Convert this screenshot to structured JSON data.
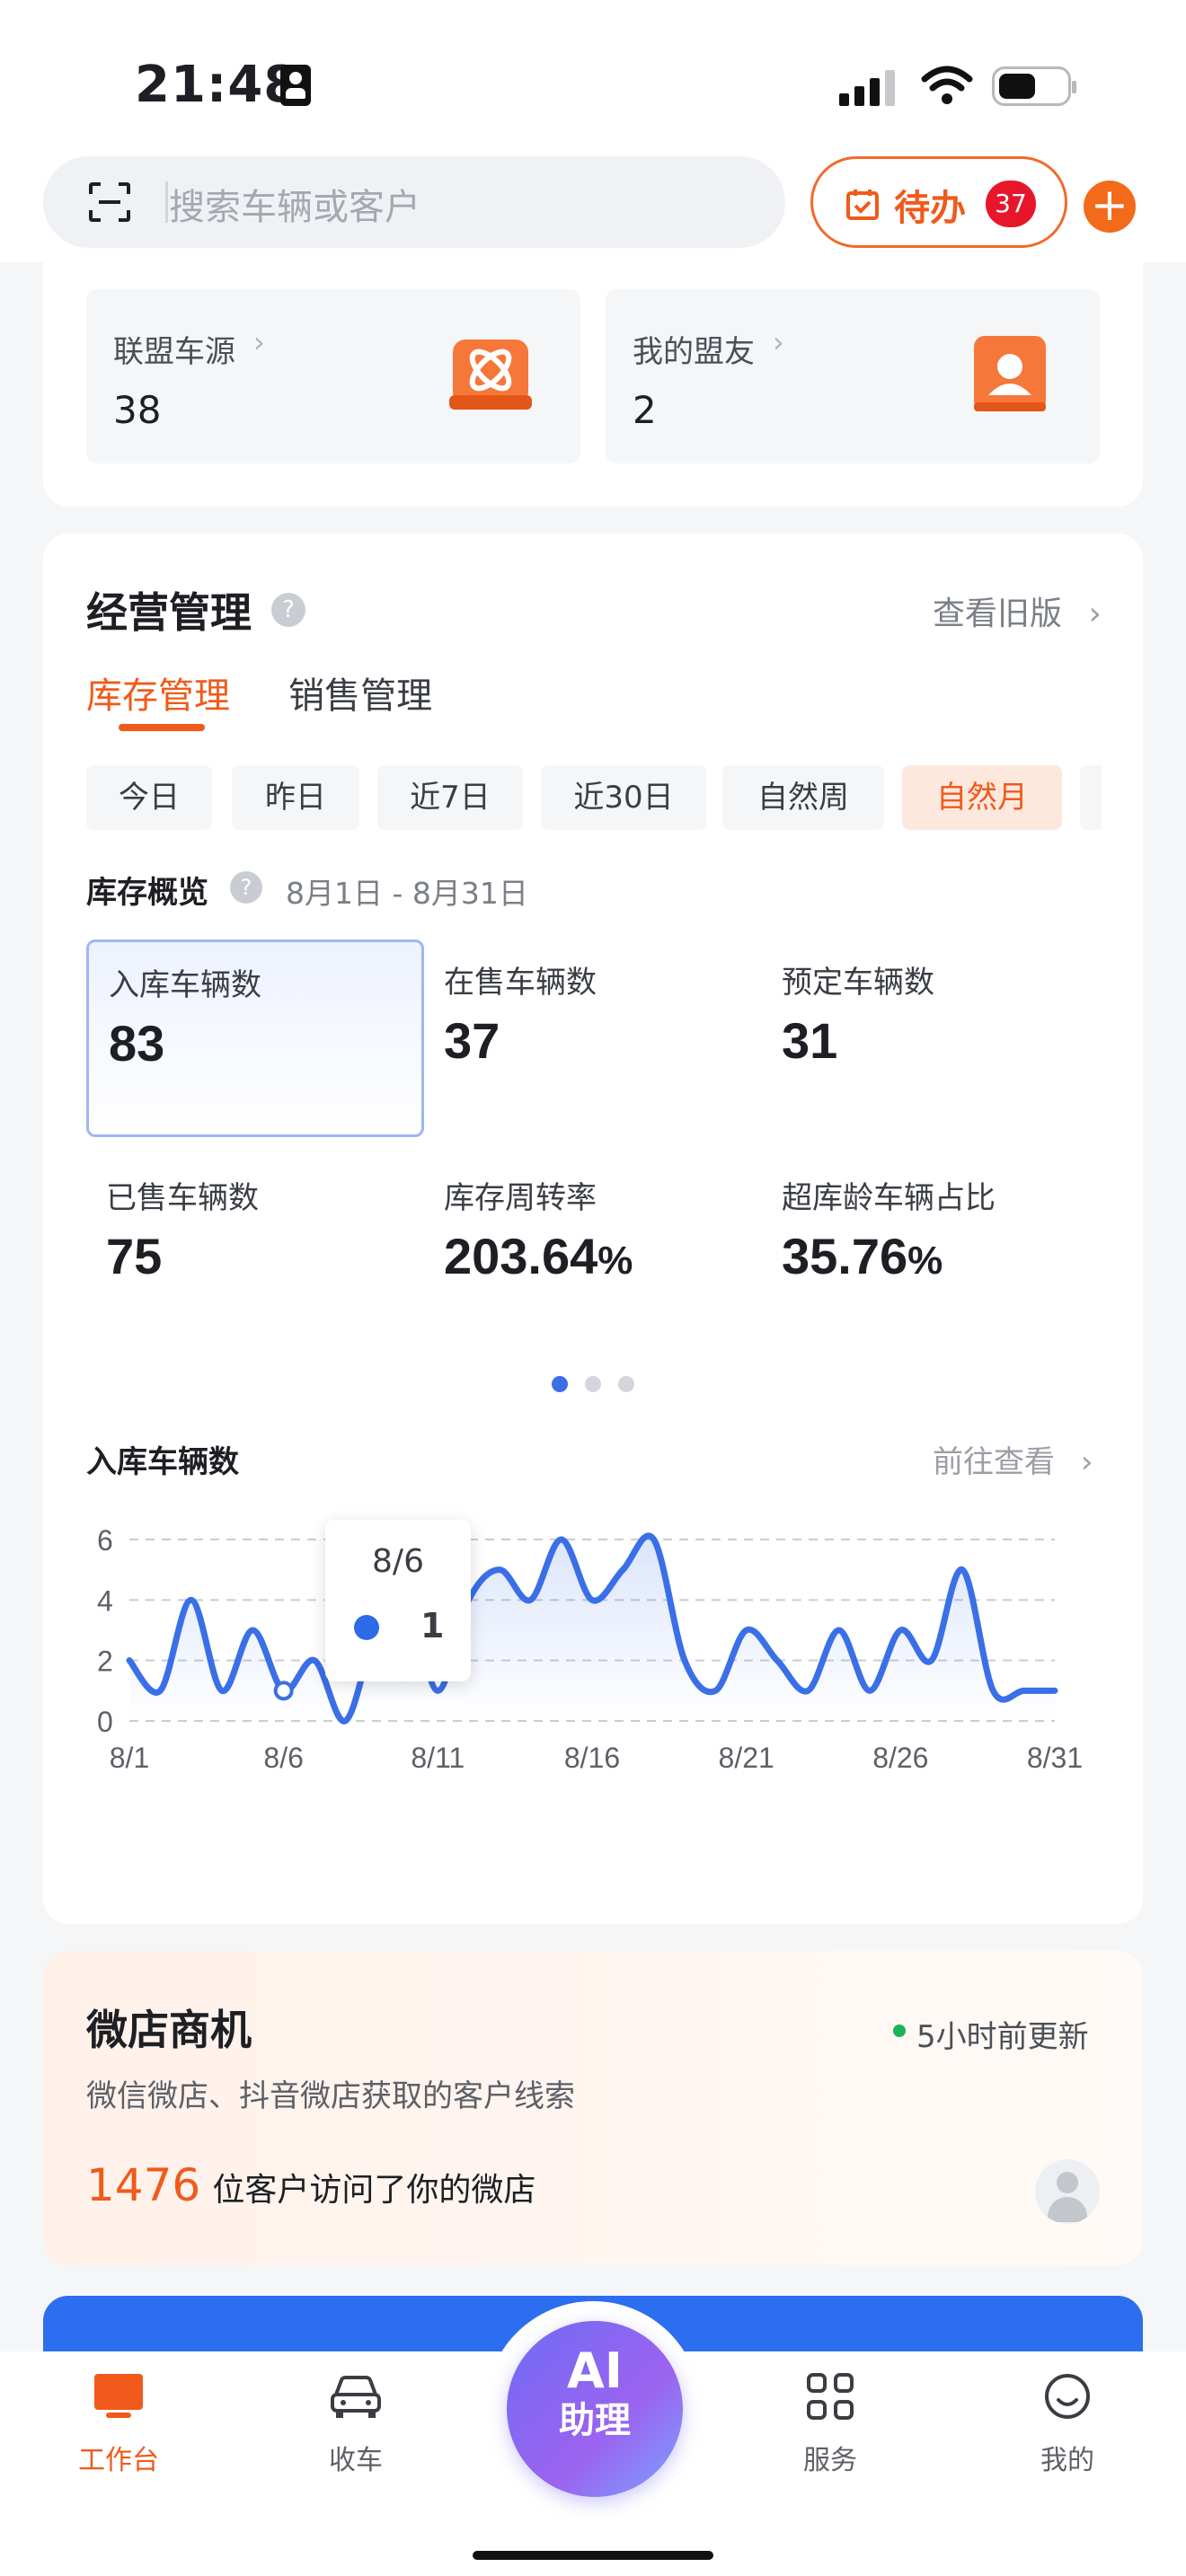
{
  "status": {
    "time": "21:48"
  },
  "search": {
    "placeholder": "搜索车辆或客户"
  },
  "todo": {
    "label": "待办",
    "count": "37"
  },
  "alliance": [
    {
      "label": "联盟车源",
      "value": "38"
    },
    {
      "label": "我的盟友",
      "value": "2"
    }
  ],
  "business": {
    "title": "经营管理",
    "old_version": "查看旧版",
    "tabs": [
      "库存管理",
      "销售管理"
    ],
    "ranges": [
      "今日",
      "昨日",
      "近7日",
      "近30日",
      "自然周",
      "自然月"
    ],
    "overview_label": "库存概览",
    "date_range": "8月1日 - 8月31日",
    "metrics": [
      {
        "label": "入库车辆数",
        "value": "83"
      },
      {
        "label": "在售车辆数",
        "value": "37"
      },
      {
        "label": "预定车辆数",
        "value": "31"
      },
      {
        "label": "已售车辆数",
        "value": "75"
      },
      {
        "label": "库存周转率",
        "value": "203.64",
        "unit": "%"
      },
      {
        "label": "超库龄车辆占比",
        "value": "35.76",
        "unit": "%"
      }
    ],
    "chart_title": "入库车辆数",
    "chart_link": "前往查看",
    "tooltip": {
      "date": "8/6",
      "value": "1"
    }
  },
  "chart_data": {
    "type": "line",
    "x": [
      "8/1",
      "8/2",
      "8/3",
      "8/4",
      "8/5",
      "8/6",
      "8/7",
      "8/8",
      "8/9",
      "8/10",
      "8/11",
      "8/12",
      "8/13",
      "8/14",
      "8/15",
      "8/16",
      "8/17",
      "8/18",
      "8/19",
      "8/20",
      "8/21",
      "8/22",
      "8/23",
      "8/24",
      "8/25",
      "8/26",
      "8/27",
      "8/28",
      "8/29",
      "8/30",
      "8/31"
    ],
    "x_ticks": [
      "8/1",
      "8/6",
      "8/11",
      "8/16",
      "8/21",
      "8/26",
      "8/31"
    ],
    "series": [
      {
        "values": [
          2,
          1,
          4,
          1,
          3,
          1,
          2,
          0,
          3,
          4,
          1,
          4,
          5,
          4,
          6,
          4,
          5,
          6,
          2,
          1,
          3,
          2,
          1,
          3,
          1,
          3,
          2,
          5,
          1,
          1,
          1
        ]
      }
    ],
    "ylim": [
      0,
      6
    ],
    "y_ticks": [
      "0",
      "2",
      "4",
      "6"
    ],
    "grid": true,
    "color": "#3a6fe8"
  },
  "shop": {
    "title": "微店商机",
    "updated": "5小时前更新",
    "subtitle": "微信微店、抖音微店获取的客户线索",
    "count": "1476",
    "visit_text": "位客户访问了你的微店"
  },
  "bottom_nav": {
    "ai_line1": "AI",
    "ai_line2": "助理",
    "items": [
      {
        "label": "工作台",
        "active": true
      },
      {
        "label": "收车"
      },
      {
        "label": "服务"
      },
      {
        "label": "我的"
      }
    ]
  },
  "colors": {
    "accent": "#f05a1a",
    "blue": "#3a6fe8",
    "badge": "#e8162b"
  }
}
